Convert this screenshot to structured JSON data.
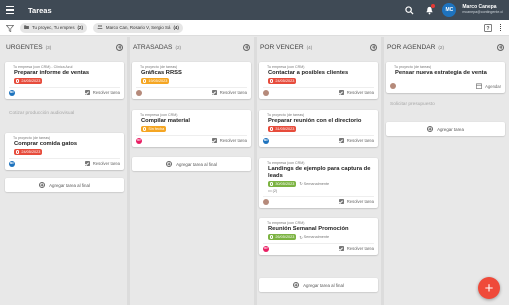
{
  "app": {
    "title": "Tareas"
  },
  "user": {
    "name": "Marco Canepa",
    "email": "mcanepa@contingente.cl",
    "initials": "MC"
  },
  "filters": [
    {
      "label": "Tu proyec, Tu empres",
      "count": "(2)"
    },
    {
      "label": "Marco Can, Rosario V, Sergio Sá",
      "count": "(4)"
    }
  ],
  "columns": [
    {
      "title": "URGENTES",
      "count": "(3)"
    },
    {
      "title": "ATRASADAS",
      "count": "(2)"
    },
    {
      "title": "POR VENCER",
      "count": "(4)"
    },
    {
      "title": "POR AGENDAR",
      "count": "(2)"
    }
  ],
  "cards": {
    "u1": {
      "project": "Tu empresa (con CRM) - Clínica Azul",
      "name": "Preparar informe de ventas",
      "date": "24/05/2023",
      "avatar": "MC",
      "action": "Resolver tarea"
    },
    "u2": {
      "project": "Cotizar producción audiovisual"
    },
    "u3": {
      "project": "Tu proyecto (de tareas)",
      "name": "Comprar comida gatos",
      "date": "24/05/2023",
      "avatar": "MC",
      "action": "Resolver tarea"
    },
    "a1": {
      "project": "Tu proyecto (de tareas)",
      "name": "Gráficas RRSS",
      "date": "19/05/2023",
      "action": "Resolver tarea"
    },
    "a2": {
      "project": "Tu empresa (con CRM)",
      "name": "Compilar material",
      "date": "Sin fecha",
      "avatar": "RV",
      "action": "Resolver tarea"
    },
    "p1": {
      "project": "Tu empresa (con CRM)",
      "name": "Contactar a posibles clientes",
      "date": "24/05/2023",
      "action": "Resolver tarea"
    },
    "p2": {
      "project": "Tu proyecto (de tareas)",
      "name": "Preparar reunión con el directorio",
      "date": "31/05/2023",
      "avatar": "MC",
      "action": "Resolver tarea"
    },
    "p3": {
      "project": "Tu empresa (con CRM)",
      "name": "Landings de ejemplo para captura de leads",
      "date": "30/05/2023",
      "recur": "Semanalmente",
      "attach": "(2)",
      "action": "Resolver tarea"
    },
    "p4": {
      "project": "Tu empresa (con CRM)",
      "name": "Reunión Semanal Promoción",
      "date": "26/05/2023",
      "recur": "Semanalmente",
      "avatar": "RV",
      "action": "Resolver tarea"
    },
    "g1": {
      "project": "Tu proyecto (de tareas)",
      "name": "Pensar nueva estrategia de venta",
      "action": "Agendar"
    },
    "g2": {
      "project": "Solicitar presupuesto"
    }
  },
  "add_first": "Agregar tarea al final",
  "add_atrasadas": "Agregar tarea al final",
  "add_porvencer": "Agregar tarea al final",
  "add_agendar": "Agregar tarea"
}
